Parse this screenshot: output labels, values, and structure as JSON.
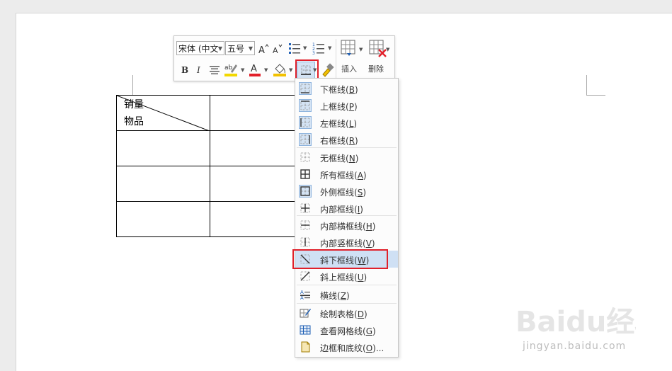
{
  "toolbar": {
    "font_name": "宋体 (中文",
    "font_size": "五号",
    "insert_label": "插入",
    "delete_label": "删除",
    "colors": {
      "highlight": "#f2d800",
      "font_color": "#e3202a",
      "shading": "#f2c100",
      "bullet_accent": "#1f5fb4"
    }
  },
  "table": {
    "header_top": "销量",
    "header_bottom": "物品"
  },
  "menu": {
    "items": [
      {
        "label": "下框线",
        "key": "B",
        "icon": "border-bottom-icon"
      },
      {
        "label": "上框线",
        "key": "P",
        "icon": "border-top-icon"
      },
      {
        "label": "左框线",
        "key": "L",
        "icon": "border-left-icon"
      },
      {
        "label": "右框线",
        "key": "R",
        "icon": "border-right-icon"
      },
      {
        "label": "无框线",
        "key": "N",
        "icon": "border-none-icon"
      },
      {
        "label": "所有框线",
        "key": "A",
        "icon": "border-all-icon"
      },
      {
        "label": "外侧框线",
        "key": "S",
        "icon": "border-outside-icon"
      },
      {
        "label": "内部框线",
        "key": "I",
        "icon": "border-inside-icon"
      },
      {
        "label": "内部横框线",
        "key": "H",
        "icon": "border-inside-horizontal-icon"
      },
      {
        "label": "内部竖框线",
        "key": "V",
        "icon": "border-inside-vertical-icon"
      },
      {
        "label": "斜下框线",
        "key": "W",
        "icon": "border-diagonal-down-icon"
      },
      {
        "label": "斜上框线",
        "key": "U",
        "icon": "border-diagonal-up-icon"
      },
      {
        "label": "横线",
        "key": "Z",
        "icon": "horizontal-line-icon"
      },
      {
        "label": "绘制表格",
        "key": "D",
        "icon": "draw-table-icon"
      },
      {
        "label": "查看网格线",
        "key": "G",
        "icon": "view-gridlines-icon"
      },
      {
        "label": "边框和底纹",
        "key": "O",
        "suffix": "...",
        "icon": "borders-and-shading-icon"
      }
    ]
  },
  "watermark": {
    "brand": "Baidu经验",
    "url": "jingyan.baidu.com"
  }
}
